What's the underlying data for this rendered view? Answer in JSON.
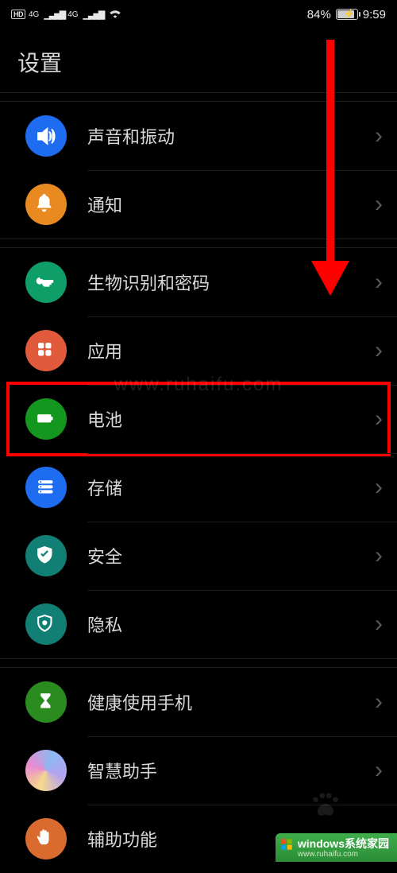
{
  "status": {
    "hd": "HD",
    "net": "4G",
    "battery_pct": "84%",
    "time": "9:59"
  },
  "page_title": "设置",
  "sections": [
    {
      "items": [
        {
          "id": "sound",
          "label": "声音和振动",
          "icon": "volume-icon",
          "bg": "#1e6df0"
        },
        {
          "id": "notif",
          "label": "通知",
          "icon": "bell-icon",
          "bg": "#e88a1f"
        }
      ]
    },
    {
      "items": [
        {
          "id": "biometric",
          "label": "生物识别和密码",
          "icon": "key-icon",
          "bg": "#0f9e68"
        },
        {
          "id": "apps",
          "label": "应用",
          "icon": "apps-icon",
          "bg": "#e25a3c"
        },
        {
          "id": "battery",
          "label": "电池",
          "icon": "battery-icon",
          "bg": "#13971e",
          "highlight": true
        },
        {
          "id": "storage",
          "label": "存储",
          "icon": "storage-icon",
          "bg": "#1e6df0"
        },
        {
          "id": "security",
          "label": "安全",
          "icon": "shield-check-icon",
          "bg": "#117f74"
        },
        {
          "id": "privacy",
          "label": "隐私",
          "icon": "shield-dot-icon",
          "bg": "#117f74"
        }
      ]
    },
    {
      "items": [
        {
          "id": "health",
          "label": "健康使用手机",
          "icon": "hourglass-icon",
          "bg": "#2a8c1f"
        },
        {
          "id": "assist",
          "label": "智慧助手",
          "icon": "gradient-icon",
          "bg": "gradient"
        },
        {
          "id": "access",
          "label": "辅助功能",
          "icon": "hand-icon",
          "bg": "#d96b2e"
        }
      ]
    }
  ],
  "watermark_center": "www.ruhaifu.com",
  "watermark_corner": {
    "line1": "windows系统家园",
    "line2": "www.ruhaifu.com"
  }
}
